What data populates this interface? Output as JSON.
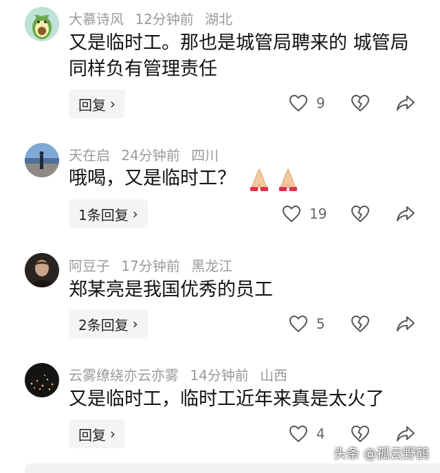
{
  "comments": [
    {
      "username": "大慕诗风",
      "time": "12分钟前",
      "location": "湖北",
      "text": "又是临时工。那也是城管局聘来的 城管局同样负有管理责任",
      "reply_label": "回复",
      "likes": "9",
      "avatar": "avocado-avatar"
    },
    {
      "username": "天在启",
      "time": "24分钟前",
      "location": "四川",
      "text": "哦喝，又是临时工？",
      "emoji": "praying-hands-emoji",
      "reply_label": "1条回复",
      "likes": "19",
      "avatar": "landscape-avatar"
    },
    {
      "username": "阿豆子",
      "time": "17分钟前",
      "location": "黑龙江",
      "text": "郑某亮是我国优秀的员工",
      "reply_label": "2条回复",
      "likes": "5",
      "avatar": "portrait-avatar"
    },
    {
      "username": "云雾缭绕亦云亦雾",
      "time": "14分钟前",
      "location": "山西",
      "text": "又是临时工，临时工近年来真是太火了",
      "reply_label": "回复",
      "likes": "4",
      "avatar": "night-city-avatar"
    }
  ],
  "watermark": "头条 @孤云野鹤",
  "icons": {
    "like": "heart-outline-icon",
    "dislike": "broken-heart-icon",
    "share": "share-arrow-icon",
    "chevron": "chevron-right-icon"
  }
}
